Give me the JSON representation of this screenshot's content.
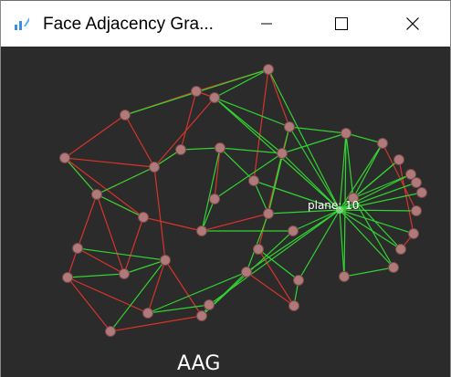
{
  "window": {
    "title": "Face Adjacency Gra...",
    "icons": {
      "app": "graph-app-icon",
      "minimize": "minimize-icon",
      "maximize": "maximize-icon",
      "close": "close-icon"
    }
  },
  "graph": {
    "caption": "AAG",
    "highlight_label": "plane: 10",
    "colors": {
      "background": "#2b2b2b",
      "node_fill": "#b07a7a",
      "node_stroke": "#7a4a4a",
      "highlight_node": "#7dd37d",
      "edge_red": "#d8332b",
      "edge_green": "#32d332"
    }
  }
}
